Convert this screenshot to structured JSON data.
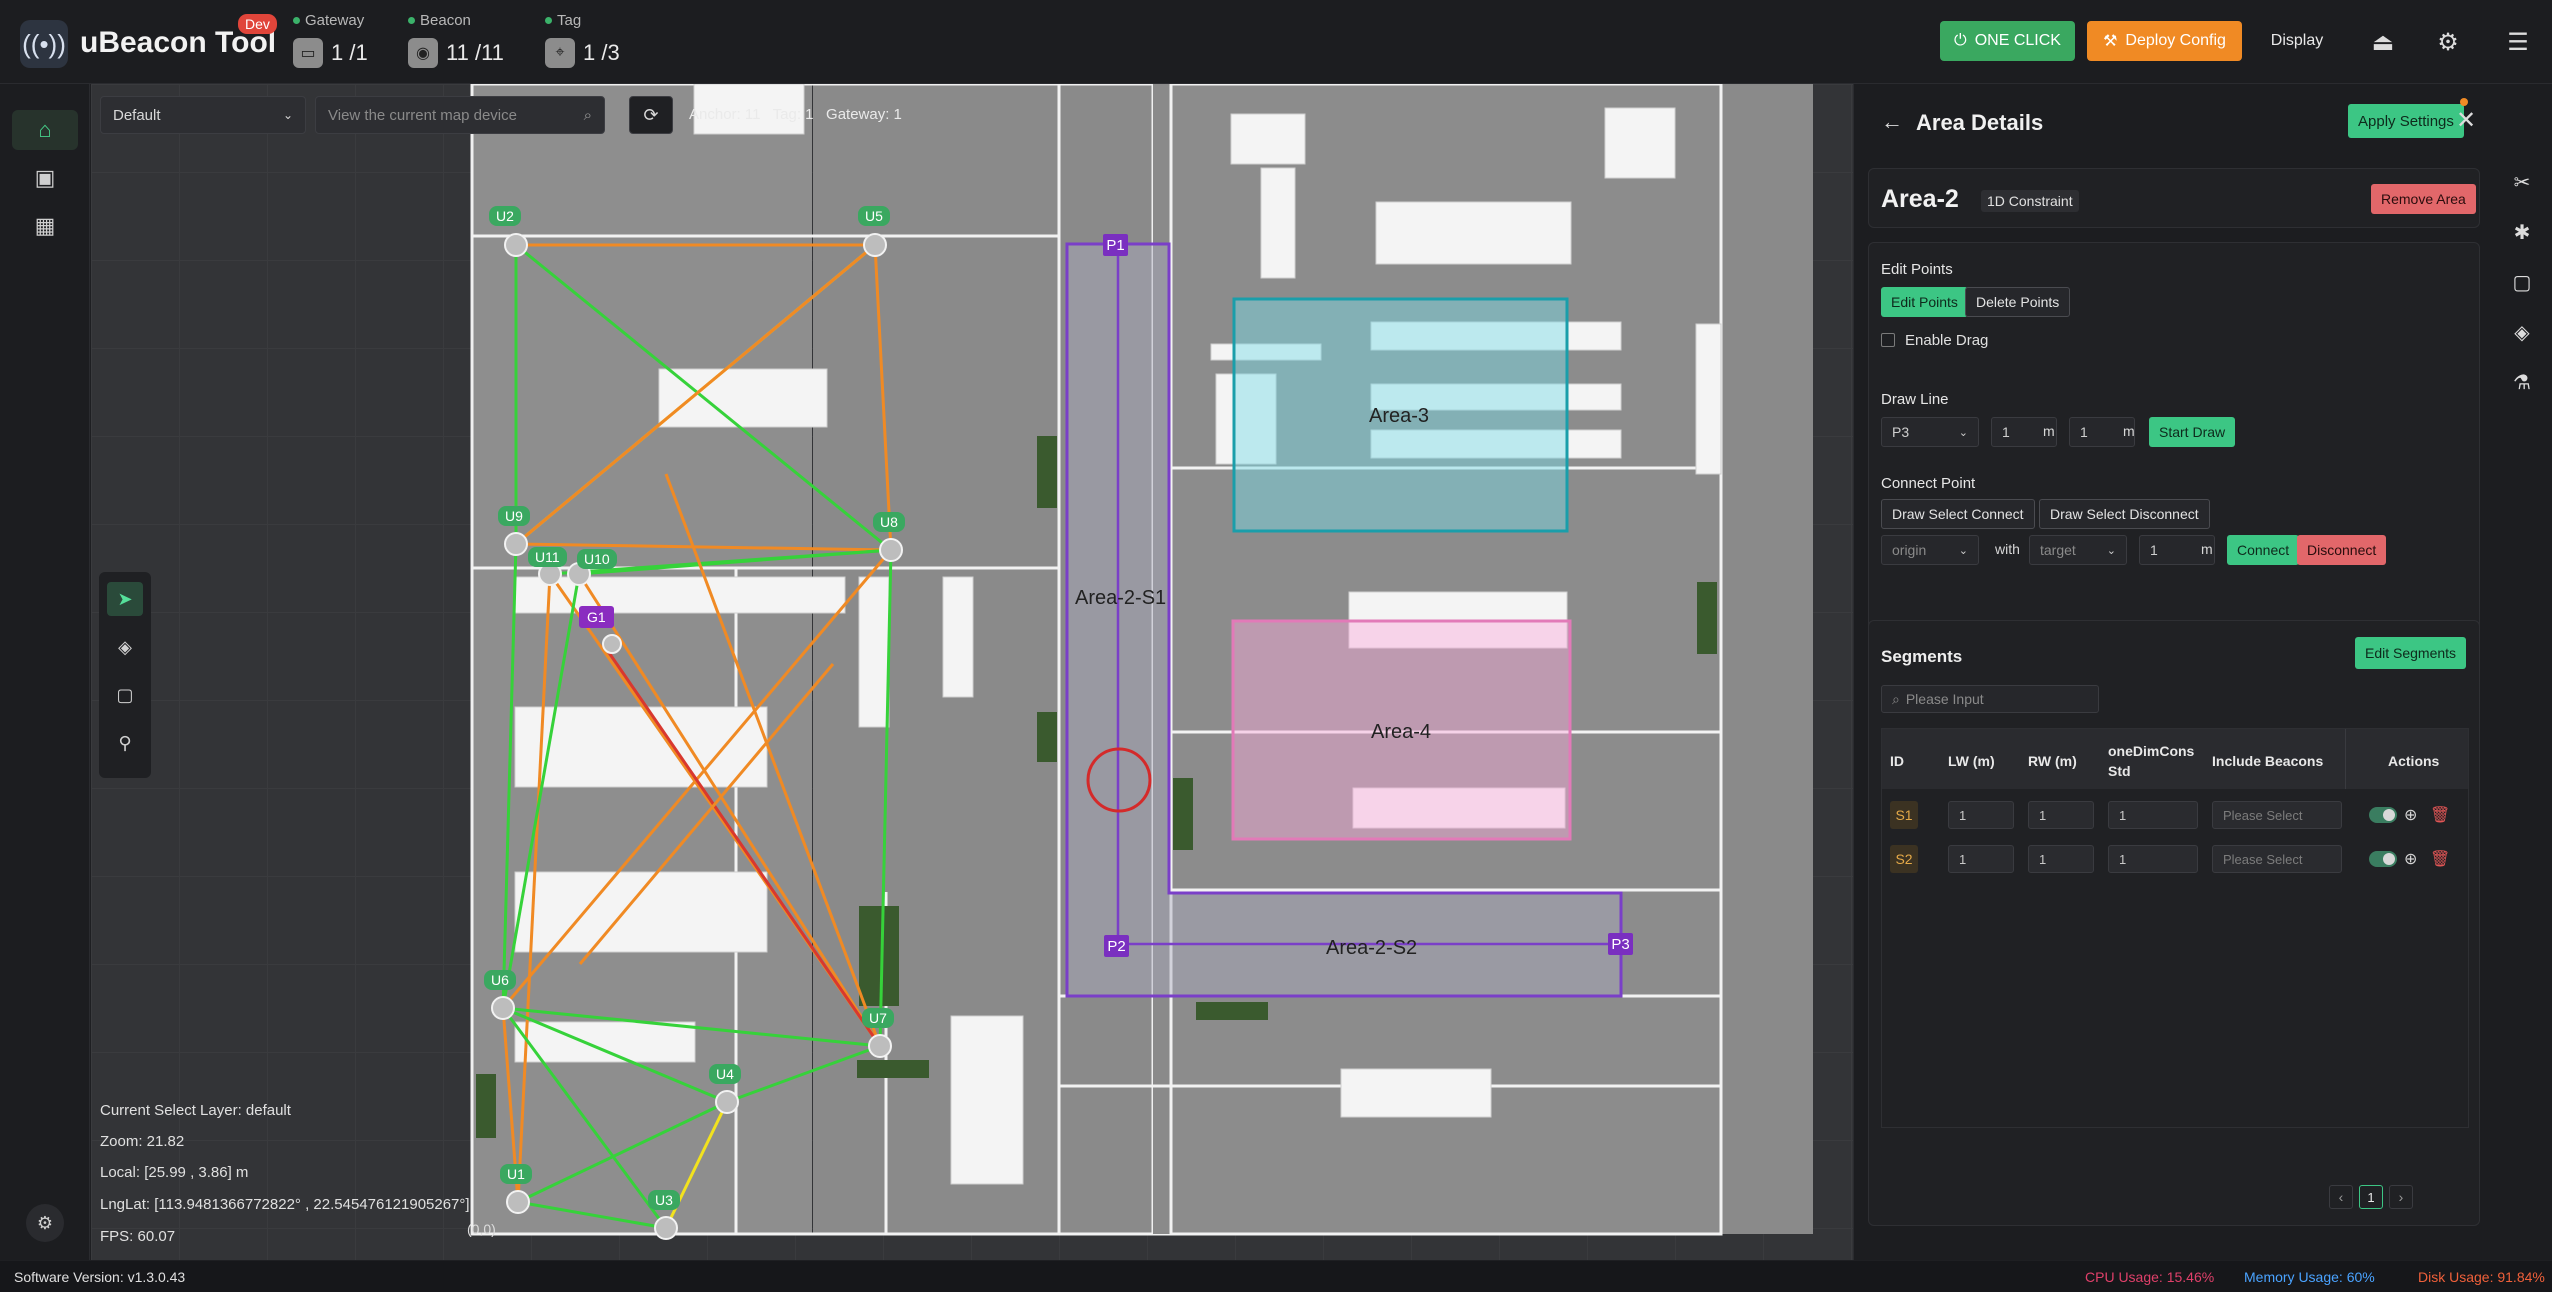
{
  "app": {
    "title": "uBeacon Tool",
    "badge": "Dev"
  },
  "stats": [
    {
      "label": "Gateway",
      "value": "1 /1",
      "icon": "gateway-icon"
    },
    {
      "label": "Beacon",
      "value": "11 /11",
      "icon": "beacon-icon"
    },
    {
      "label": "Tag",
      "value": "1 /3",
      "icon": "tag-icon"
    }
  ],
  "header": {
    "one_click": "ONE CLICK",
    "deploy_config": "Deploy Config",
    "display": "Display"
  },
  "map_toolbar": {
    "layer_select": "Default",
    "device_search_placeholder": "View the current map device",
    "counts": "Anchor: 11   Tag: 1   Gateway: 1"
  },
  "map_info": {
    "layer": "Current Select Layer:   default",
    "zoom": "Zoom:   21.82",
    "local": "Local:   [25.99 ,  3.86] m",
    "lnglat": "LngLat:   [113.9481366772822° ,  22.545476121905267°]",
    "fps": "FPS:   60.07"
  },
  "map": {
    "areas": [
      "Area-2-S1",
      "Area-2-S2",
      "Area-3",
      "Area-4"
    ],
    "points": [
      "P1",
      "P2",
      "P3"
    ],
    "anchors": [
      "U1",
      "U2",
      "U3",
      "U4",
      "U5",
      "U6",
      "U7",
      "U8",
      "U9",
      "U10",
      "U11"
    ],
    "gateway": "G1",
    "origin": "(0,0)"
  },
  "panel": {
    "title": "Area Details",
    "apply_settings": "Apply Settings",
    "area_name": "Area-2",
    "area_type": "1D Constraint",
    "remove_area": "Remove Area",
    "edit_points_title": "Edit Points",
    "edit_points_btn": "Edit Points",
    "delete_points_btn": "Delete Points",
    "enable_drag": "Enable Drag",
    "draw_line_title": "Draw Line",
    "draw_line_point": "P3",
    "draw_line_v1": "1",
    "draw_line_v2": "1",
    "unit_m": "m",
    "start_draw": "Start Draw",
    "connect_point_title": "Connect Point",
    "draw_select_connect": "Draw Select Connect",
    "draw_select_disconnect": "Draw Select Disconnect",
    "origin_placeholder": "origin",
    "with_label": "with",
    "target_placeholder": "target",
    "connect_dist": "1",
    "connect_btn": "Connect",
    "disconnect_btn": "Disconnect",
    "segments_title": "Segments",
    "edit_segments": "Edit Segments",
    "segments_search_placeholder": "Please Input",
    "columns": [
      "ID",
      "LW (m)",
      "RW (m)",
      "oneDimCons Std",
      "Include Beacons",
      "Actions"
    ],
    "rows": [
      {
        "id": "S1",
        "lw": "1",
        "rw": "1",
        "std": "1",
        "beacons": "Please Select"
      },
      {
        "id": "S2",
        "lw": "1",
        "rw": "1",
        "std": "1",
        "beacons": "Please Select"
      }
    ],
    "page": "1"
  },
  "footer": {
    "version": "Software Version:  v1.3.0.43",
    "cpu": "CPU Usage:  15.46%",
    "memory": "Memory Usage:  60%",
    "disk": "Disk Usage:  91.84%"
  },
  "colors": {
    "accent": "#3cc684",
    "deploy": "#f08a24",
    "cpu": "#e0406a",
    "memory": "#4aa3ff",
    "disk": "#f0603a",
    "area_purple": "#7a3fc8"
  }
}
